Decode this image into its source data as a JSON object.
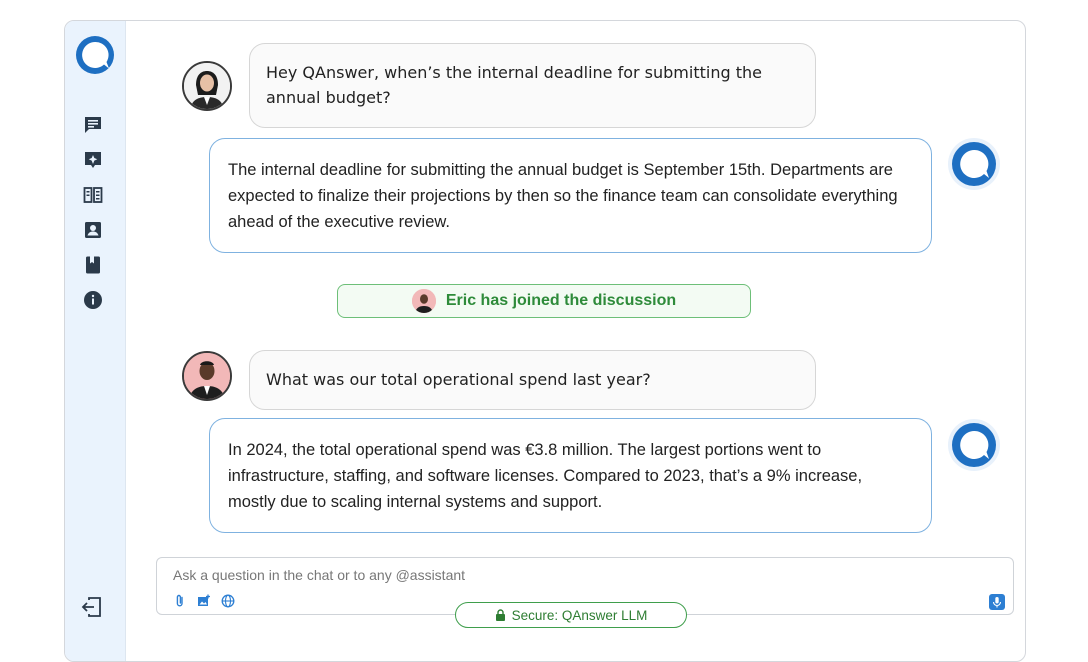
{
  "app": {
    "name": "QAnswer"
  },
  "sidebar": {
    "items": [
      {
        "name": "chat-icon"
      },
      {
        "name": "assistant-icon"
      },
      {
        "name": "documents-icon"
      },
      {
        "name": "contacts-icon"
      },
      {
        "name": "library-icon"
      },
      {
        "name": "info-icon"
      }
    ],
    "exit_icon": "logout-icon"
  },
  "messages": [
    {
      "role": "user",
      "text": "Hey QAnswer, when’s the internal deadline for submitting the annual budget?"
    },
    {
      "role": "assistant",
      "text": "The internal deadline for submitting the annual budget is September 15th. Departments are expected to finalize their projections by then so the finance team can consolidate everything ahead of the executive review."
    },
    {
      "role": "system",
      "text": "Eric has joined the discussion"
    },
    {
      "role": "user",
      "text": "What was our total operational spend last year?"
    },
    {
      "role": "assistant",
      "text": "In 2024, the total operational spend was €3.8 million. The largest portions went to infrastructure, staffing, and software licenses. Compared to 2023, that’s a 9% increase, mostly due to scaling internal systems and support."
    }
  ],
  "composer": {
    "placeholder": "Ask a question in the chat or to any @assistant",
    "value": "",
    "tools": [
      "attach-icon",
      "image-icon",
      "globe-icon"
    ],
    "mic_icon": "microphone-icon"
  },
  "secure_badge": "Secure: QAnswer LLM",
  "colors": {
    "accent": "#1e6fc2",
    "success": "#2e8b3a",
    "sidebar_bg": "#eaf3fd"
  }
}
